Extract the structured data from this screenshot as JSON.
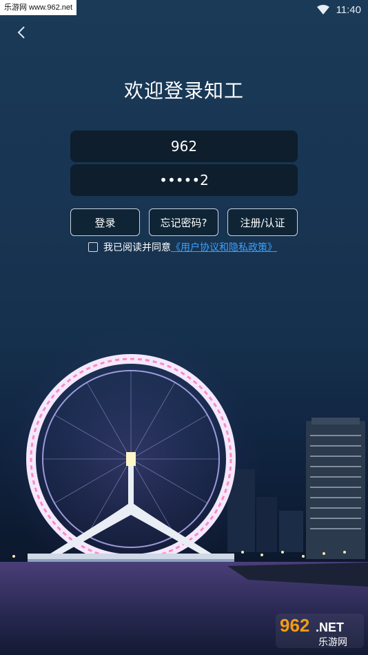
{
  "status_bar": {
    "watermark": "乐游网 www.962.net",
    "time": "11:40",
    "wifi_icon": "wifi-icon",
    "signal_icon": "signal-icon"
  },
  "header": {
    "back_icon": "chevron-left-icon",
    "title": "欢迎登录知工"
  },
  "login_form": {
    "account_value": "962",
    "password_value": "•••••2"
  },
  "buttons": {
    "login": "登录",
    "forgot_password": "忘记密码?",
    "register": "注册/认证"
  },
  "agreement": {
    "checked": false,
    "text": "我已阅读并同意",
    "link": "《用户协议和隐私政策》"
  },
  "watermark_bottom": {
    "logo_number": "962",
    "logo_suffix": ".NET",
    "logo_cn": "乐游网"
  },
  "colors": {
    "accent_link": "#3aa0ff",
    "field_bg": "#0e1e2c"
  }
}
